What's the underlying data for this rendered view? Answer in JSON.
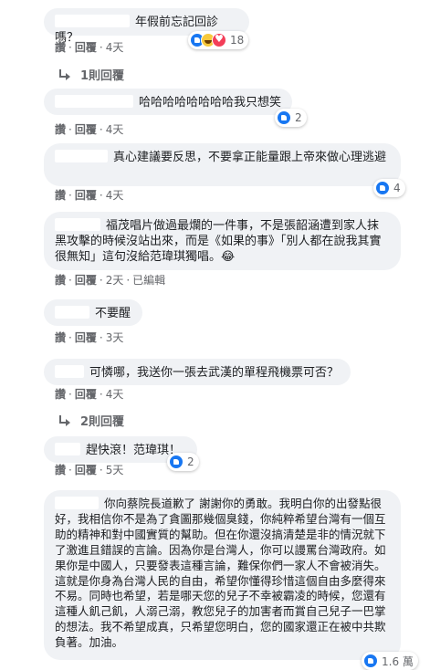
{
  "colors": {
    "bubble": "#f0f2f5",
    "meta": "#65676b",
    "like": "#1877f2",
    "haha": "#f7c93c",
    "love": "#f33e58"
  },
  "icons": {
    "like": "like-reaction-icon",
    "haha": "haha-reaction-icon",
    "love": "love-reaction-icon",
    "reply": "reply-arrow-icon"
  },
  "actions": {
    "like": "讚",
    "reply": "回覆",
    "edited": "已編輯",
    "dot": "·"
  },
  "comments": [
    {
      "text": "年假前忘記回診嗎？",
      "time": "4天",
      "reactions": [
        "like",
        "haha",
        "love"
      ],
      "reaction_count": "18"
    },
    {
      "text": "哈哈哈哈哈哈哈哈我只想笑",
      "time": "4天",
      "reactions": [
        "like"
      ],
      "reaction_count": "2"
    },
    {
      "text": "真心建議要反思，不要拿正能量跟上帝來做心理逃避",
      "time": "4天",
      "reactions": [
        "like"
      ],
      "reaction_count": "4"
    },
    {
      "text": "福茂唱片做過最爛的一件事，不是張韶涵遭到家人抹黑攻擊的時候沒站出來，而是《如果的事》「別人都在說我其實很無知」這句沒給范瑋琪獨唱。😂",
      "time": "2天"
    },
    {
      "text": "不要醒",
      "time": "3天"
    },
    {
      "text": "可憐哪，我送你一張去武漢的單程飛機票可否？",
      "time": "4天"
    },
    {
      "text": "趕快滾！范瑋琪！",
      "time": "5天",
      "reactions": [
        "like"
      ],
      "reaction_count": "2"
    },
    {
      "text": "你向蔡院長道歉了 謝謝你的勇敢。我明白你的出發點很好，我相信你不是為了貪圖那幾個臭錢，你純粹希望台灣有一個互助的精神和對中國實質的幫助。但在你還沒搞清楚是非的情況就下了激進且錯誤的言論。因為你是台灣人，你可以謾罵台灣政府。如果你是中國人，只要發表這種言論，難保你們一家人不會被消失。這就是你身為台灣人民的自由，希望你懂得珍惜這個自由多麼得來不易。同時也希望，若是哪天您的兒子不幸被霸凌的時候，您還有這種人飢己飢，人溺己溺，教您兒子的加害者而賞自己兒子一巴掌的想法。我不希望成真，只希望您明白，您的國家還正在被中共欺負著。加油。",
      "reactions": [
        "like"
      ],
      "reaction_count": "1.6 萬"
    }
  ],
  "reply_links": [
    "1則回覆",
    "2則回覆"
  ]
}
